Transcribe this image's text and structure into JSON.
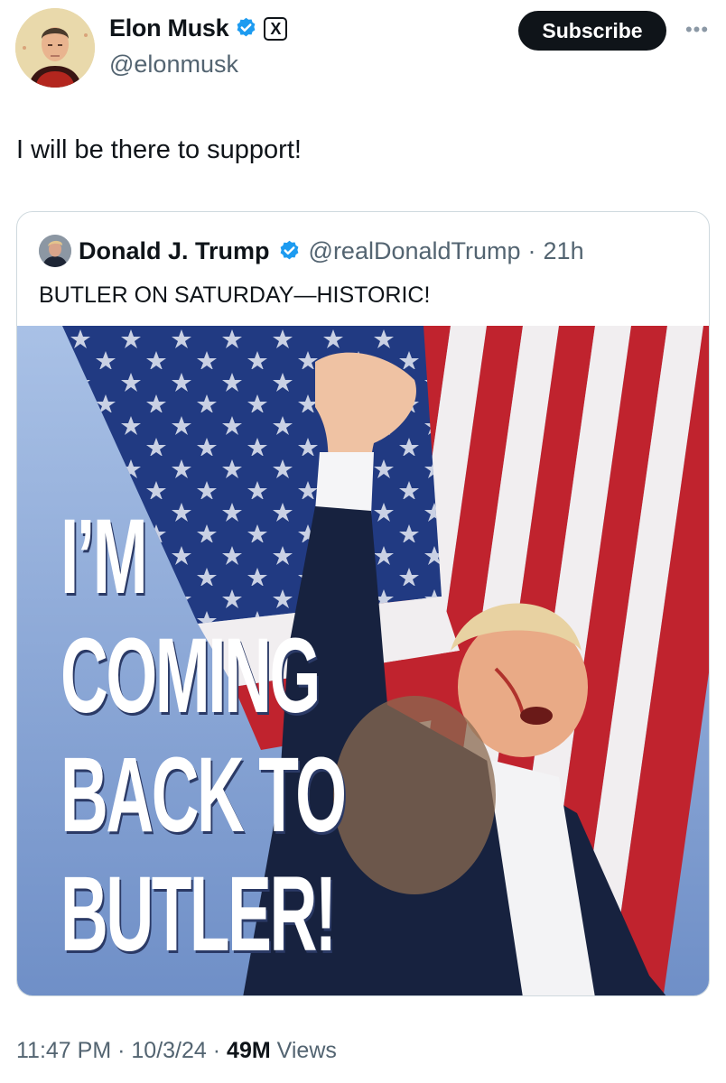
{
  "author": {
    "name": "Elon Musk",
    "handle": "@elonmusk",
    "verified_icon": "verified-badge-icon",
    "affiliate_icon": "x-logo-icon",
    "affiliate_glyph": "X"
  },
  "actions": {
    "subscribe_label": "Subscribe",
    "more_glyph": "•••"
  },
  "tweet": {
    "text": "I will be there to support!"
  },
  "quoted": {
    "name": "Donald J. Trump",
    "handle": "@realDonaldTrump",
    "separator": "·",
    "time": "21h",
    "text": "BUTLER ON SATURDAY—HISTORIC!",
    "image_text": [
      "I’M",
      "COMING",
      "BACK TO",
      "BUTLER!"
    ]
  },
  "meta": {
    "time": "11:47 PM",
    "date": "10/3/24",
    "separator": "·",
    "views_count": "49M",
    "views_label": "Views"
  },
  "colors": {
    "accent_verified": "#1d9bf0",
    "text_primary": "#0f1419",
    "text_secondary": "#536471",
    "border": "#cfd9de"
  }
}
